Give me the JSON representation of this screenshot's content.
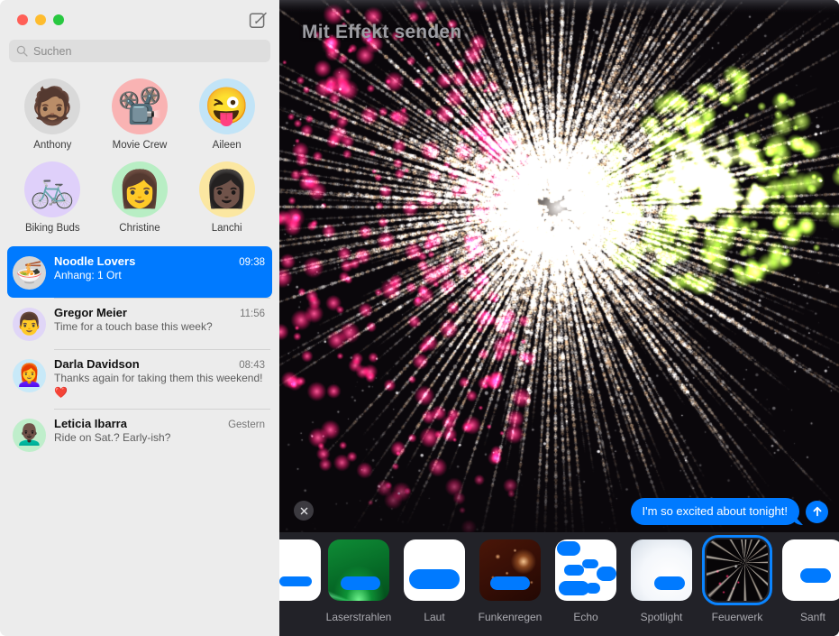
{
  "window": {
    "traffic_lights": [
      "close",
      "minimize",
      "zoom"
    ],
    "compose_icon": "compose-pencil-square-icon"
  },
  "sidebar": {
    "search": {
      "placeholder": "Suchen",
      "value": "",
      "icon": "search-icon"
    },
    "pinned": [
      {
        "label": "Anthony",
        "glyph": "🧔🏽",
        "bg": "#d9d9d9"
      },
      {
        "label": "Movie Crew",
        "glyph": "📽️",
        "bg": "#f9b3b3"
      },
      {
        "label": "Aileen",
        "glyph": "😜",
        "bg": "#c2e4f7"
      },
      {
        "label": "Biking Buds",
        "glyph": "🚲",
        "bg": "#dfd0fa"
      },
      {
        "label": "Christine",
        "glyph": "👩",
        "bg": "#b8eec4"
      },
      {
        "label": "Lanchi",
        "glyph": "👩🏿",
        "bg": "#fbe7a1"
      }
    ],
    "conversations": [
      {
        "name": "Noodle Lovers",
        "time": "09:38",
        "preview": "Anhang:  1 Ort",
        "glyph": "🍜",
        "avatar_bg": "#d6d6d6",
        "selected": true
      },
      {
        "name": "Gregor Meier",
        "time": "11:56",
        "preview": "Time for a touch base this week?",
        "glyph": "👨",
        "avatar_bg": "#e0d6f7",
        "selected": false
      },
      {
        "name": "Darla Davidson",
        "time": "08:43",
        "preview": "Thanks again for taking them this weekend! ❤️",
        "glyph": "👩‍🦰",
        "avatar_bg": "#c8e9f8",
        "selected": false
      },
      {
        "name": "Leticia Ibarra",
        "time": "Gestern",
        "preview": "Ride on Sat.? Early-ish?",
        "glyph": "👨🏿‍🦲",
        "avatar_bg": "#bfeecb",
        "selected": false
      }
    ]
  },
  "main": {
    "title": "Mit Effekt senden",
    "close_icon": "close-x-icon",
    "send_icon": "send-arrow-up-icon",
    "message_bubble": "I'm so excited about tonight!",
    "accent_color": "#007aff",
    "selection_color": "#0a84ff",
    "background_color": "#0a070b",
    "strip_background_color": "#222228"
  },
  "effects": [
    {
      "label": "",
      "thumb": "t-part",
      "selected": false,
      "partial": true
    },
    {
      "label": "Laserstrahlen",
      "thumb": "t-laser",
      "selected": false,
      "partial": false
    },
    {
      "label": "Laut",
      "thumb": "t-laut",
      "selected": false,
      "partial": false
    },
    {
      "label": "Funkenregen",
      "thumb": "t-spark",
      "selected": false,
      "partial": false
    },
    {
      "label": "Echo",
      "thumb": "t-echo",
      "selected": false,
      "partial": false
    },
    {
      "label": "Spotlight",
      "thumb": "t-spot",
      "selected": false,
      "partial": false
    },
    {
      "label": "Feuerwerk",
      "thumb": "t-fw",
      "selected": true,
      "partial": false
    },
    {
      "label": "Sanft",
      "thumb": "t-sanft",
      "selected": false,
      "partial": false
    }
  ]
}
